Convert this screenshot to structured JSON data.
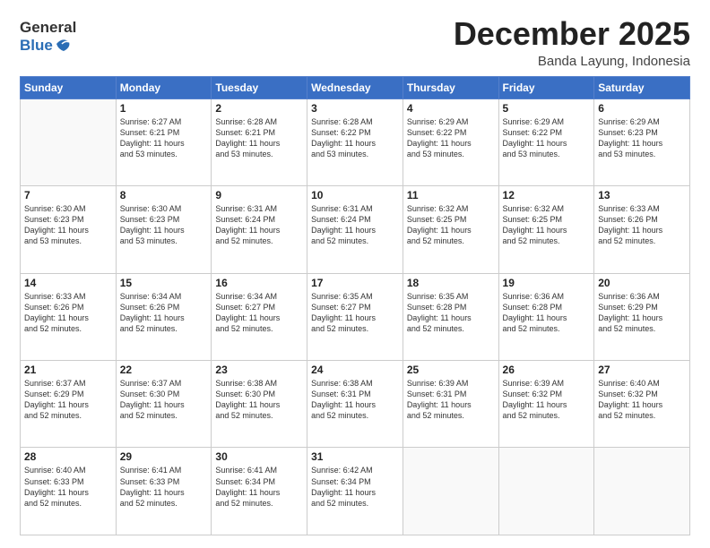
{
  "header": {
    "logo_general": "General",
    "logo_blue": "Blue",
    "month_title": "December 2025",
    "location": "Banda Layung, Indonesia"
  },
  "days_of_week": [
    "Sunday",
    "Monday",
    "Tuesday",
    "Wednesday",
    "Thursday",
    "Friday",
    "Saturday"
  ],
  "weeks": [
    [
      {
        "day": "",
        "info": ""
      },
      {
        "day": "1",
        "info": "Sunrise: 6:27 AM\nSunset: 6:21 PM\nDaylight: 11 hours\nand 53 minutes."
      },
      {
        "day": "2",
        "info": "Sunrise: 6:28 AM\nSunset: 6:21 PM\nDaylight: 11 hours\nand 53 minutes."
      },
      {
        "day": "3",
        "info": "Sunrise: 6:28 AM\nSunset: 6:22 PM\nDaylight: 11 hours\nand 53 minutes."
      },
      {
        "day": "4",
        "info": "Sunrise: 6:29 AM\nSunset: 6:22 PM\nDaylight: 11 hours\nand 53 minutes."
      },
      {
        "day": "5",
        "info": "Sunrise: 6:29 AM\nSunset: 6:22 PM\nDaylight: 11 hours\nand 53 minutes."
      },
      {
        "day": "6",
        "info": "Sunrise: 6:29 AM\nSunset: 6:23 PM\nDaylight: 11 hours\nand 53 minutes."
      }
    ],
    [
      {
        "day": "7",
        "info": "Sunrise: 6:30 AM\nSunset: 6:23 PM\nDaylight: 11 hours\nand 53 minutes."
      },
      {
        "day": "8",
        "info": "Sunrise: 6:30 AM\nSunset: 6:23 PM\nDaylight: 11 hours\nand 53 minutes."
      },
      {
        "day": "9",
        "info": "Sunrise: 6:31 AM\nSunset: 6:24 PM\nDaylight: 11 hours\nand 52 minutes."
      },
      {
        "day": "10",
        "info": "Sunrise: 6:31 AM\nSunset: 6:24 PM\nDaylight: 11 hours\nand 52 minutes."
      },
      {
        "day": "11",
        "info": "Sunrise: 6:32 AM\nSunset: 6:25 PM\nDaylight: 11 hours\nand 52 minutes."
      },
      {
        "day": "12",
        "info": "Sunrise: 6:32 AM\nSunset: 6:25 PM\nDaylight: 11 hours\nand 52 minutes."
      },
      {
        "day": "13",
        "info": "Sunrise: 6:33 AM\nSunset: 6:26 PM\nDaylight: 11 hours\nand 52 minutes."
      }
    ],
    [
      {
        "day": "14",
        "info": "Sunrise: 6:33 AM\nSunset: 6:26 PM\nDaylight: 11 hours\nand 52 minutes."
      },
      {
        "day": "15",
        "info": "Sunrise: 6:34 AM\nSunset: 6:26 PM\nDaylight: 11 hours\nand 52 minutes."
      },
      {
        "day": "16",
        "info": "Sunrise: 6:34 AM\nSunset: 6:27 PM\nDaylight: 11 hours\nand 52 minutes."
      },
      {
        "day": "17",
        "info": "Sunrise: 6:35 AM\nSunset: 6:27 PM\nDaylight: 11 hours\nand 52 minutes."
      },
      {
        "day": "18",
        "info": "Sunrise: 6:35 AM\nSunset: 6:28 PM\nDaylight: 11 hours\nand 52 minutes."
      },
      {
        "day": "19",
        "info": "Sunrise: 6:36 AM\nSunset: 6:28 PM\nDaylight: 11 hours\nand 52 minutes."
      },
      {
        "day": "20",
        "info": "Sunrise: 6:36 AM\nSunset: 6:29 PM\nDaylight: 11 hours\nand 52 minutes."
      }
    ],
    [
      {
        "day": "21",
        "info": "Sunrise: 6:37 AM\nSunset: 6:29 PM\nDaylight: 11 hours\nand 52 minutes."
      },
      {
        "day": "22",
        "info": "Sunrise: 6:37 AM\nSunset: 6:30 PM\nDaylight: 11 hours\nand 52 minutes."
      },
      {
        "day": "23",
        "info": "Sunrise: 6:38 AM\nSunset: 6:30 PM\nDaylight: 11 hours\nand 52 minutes."
      },
      {
        "day": "24",
        "info": "Sunrise: 6:38 AM\nSunset: 6:31 PM\nDaylight: 11 hours\nand 52 minutes."
      },
      {
        "day": "25",
        "info": "Sunrise: 6:39 AM\nSunset: 6:31 PM\nDaylight: 11 hours\nand 52 minutes."
      },
      {
        "day": "26",
        "info": "Sunrise: 6:39 AM\nSunset: 6:32 PM\nDaylight: 11 hours\nand 52 minutes."
      },
      {
        "day": "27",
        "info": "Sunrise: 6:40 AM\nSunset: 6:32 PM\nDaylight: 11 hours\nand 52 minutes."
      }
    ],
    [
      {
        "day": "28",
        "info": "Sunrise: 6:40 AM\nSunset: 6:33 PM\nDaylight: 11 hours\nand 52 minutes."
      },
      {
        "day": "29",
        "info": "Sunrise: 6:41 AM\nSunset: 6:33 PM\nDaylight: 11 hours\nand 52 minutes."
      },
      {
        "day": "30",
        "info": "Sunrise: 6:41 AM\nSunset: 6:34 PM\nDaylight: 11 hours\nand 52 minutes."
      },
      {
        "day": "31",
        "info": "Sunrise: 6:42 AM\nSunset: 6:34 PM\nDaylight: 11 hours\nand 52 minutes."
      },
      {
        "day": "",
        "info": ""
      },
      {
        "day": "",
        "info": ""
      },
      {
        "day": "",
        "info": ""
      }
    ]
  ]
}
